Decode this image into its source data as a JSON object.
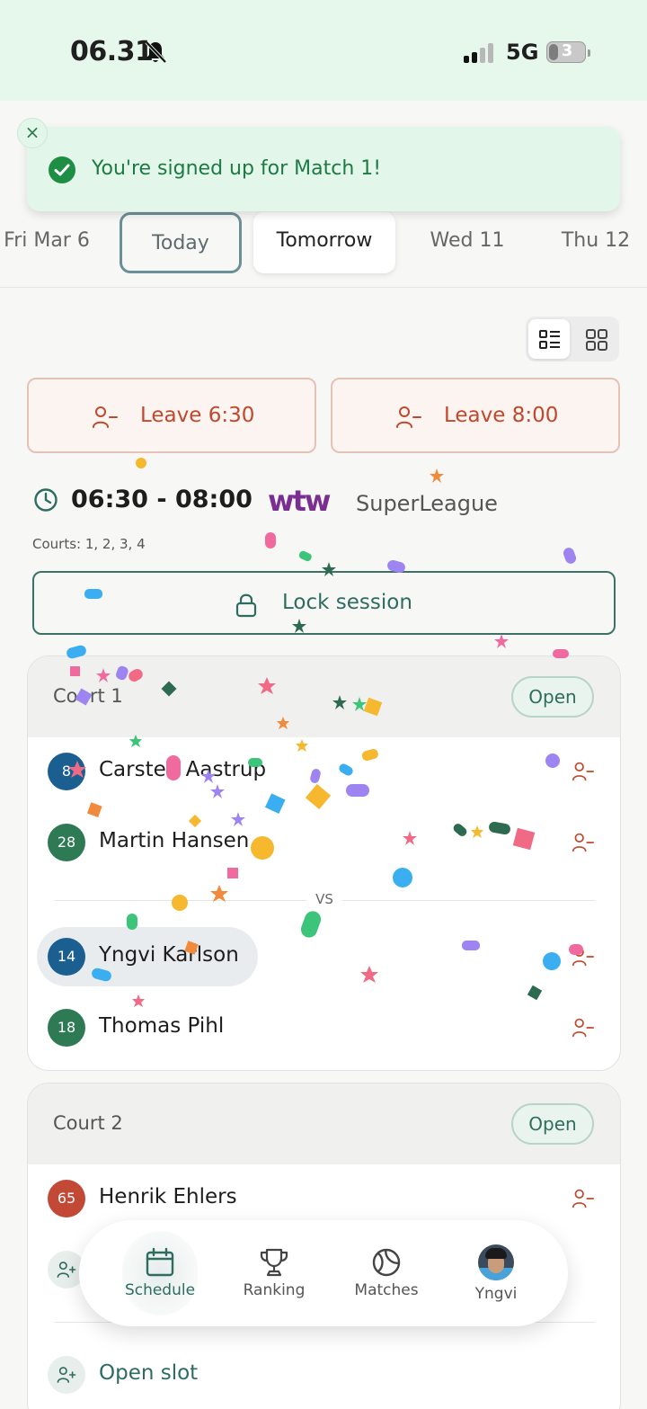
{
  "status_bar": {
    "time": "06.31",
    "network": "5G",
    "battery": "3"
  },
  "toast": {
    "message": "You're signed up for Match 1!",
    "close_icon": "×"
  },
  "date_tabs": [
    {
      "label": "Fri Mar 6"
    },
    {
      "label": "Today"
    },
    {
      "label": "Tomorrow"
    },
    {
      "label": "Wed 11"
    },
    {
      "label": "Thu 12"
    }
  ],
  "actions": {
    "leave_first": "Leave 6:30",
    "leave_second": "Leave 8:00"
  },
  "session": {
    "time_range": "06:30 - 08:00",
    "sponsor_logo": "wtw",
    "league": "SuperLeague",
    "courts": "Courts: 1, 2, 3, 4",
    "lock_label": "Lock session"
  },
  "court1": {
    "title": "Court 1",
    "status": "Open",
    "vs": "VS",
    "players": [
      {
        "rank": "8",
        "name": "Carsten Aastrup",
        "color": "#1b5f91"
      },
      {
        "rank": "28",
        "name": "Martin Hansen",
        "color": "#2e7a55"
      },
      {
        "rank": "14",
        "name": "Yngvi Karlson",
        "color": "#1b5f91"
      },
      {
        "rank": "18",
        "name": "Thomas Pihl",
        "color": "#2e7a55"
      }
    ]
  },
  "court2": {
    "title": "Court 2",
    "status": "Open",
    "players": [
      {
        "rank": "65",
        "name": "Henrik Ehlers",
        "color": "#c24935"
      }
    ],
    "open_slot_label": "Open slot"
  },
  "nav": {
    "schedule": "Schedule",
    "ranking": "Ranking",
    "matches": "Matches",
    "profile": "Yngvi"
  },
  "colors": {
    "accent": "#2e6c60",
    "leave": "#c0482c",
    "toast_bg": "#e3f6ea",
    "brand": "#7a2e91"
  }
}
